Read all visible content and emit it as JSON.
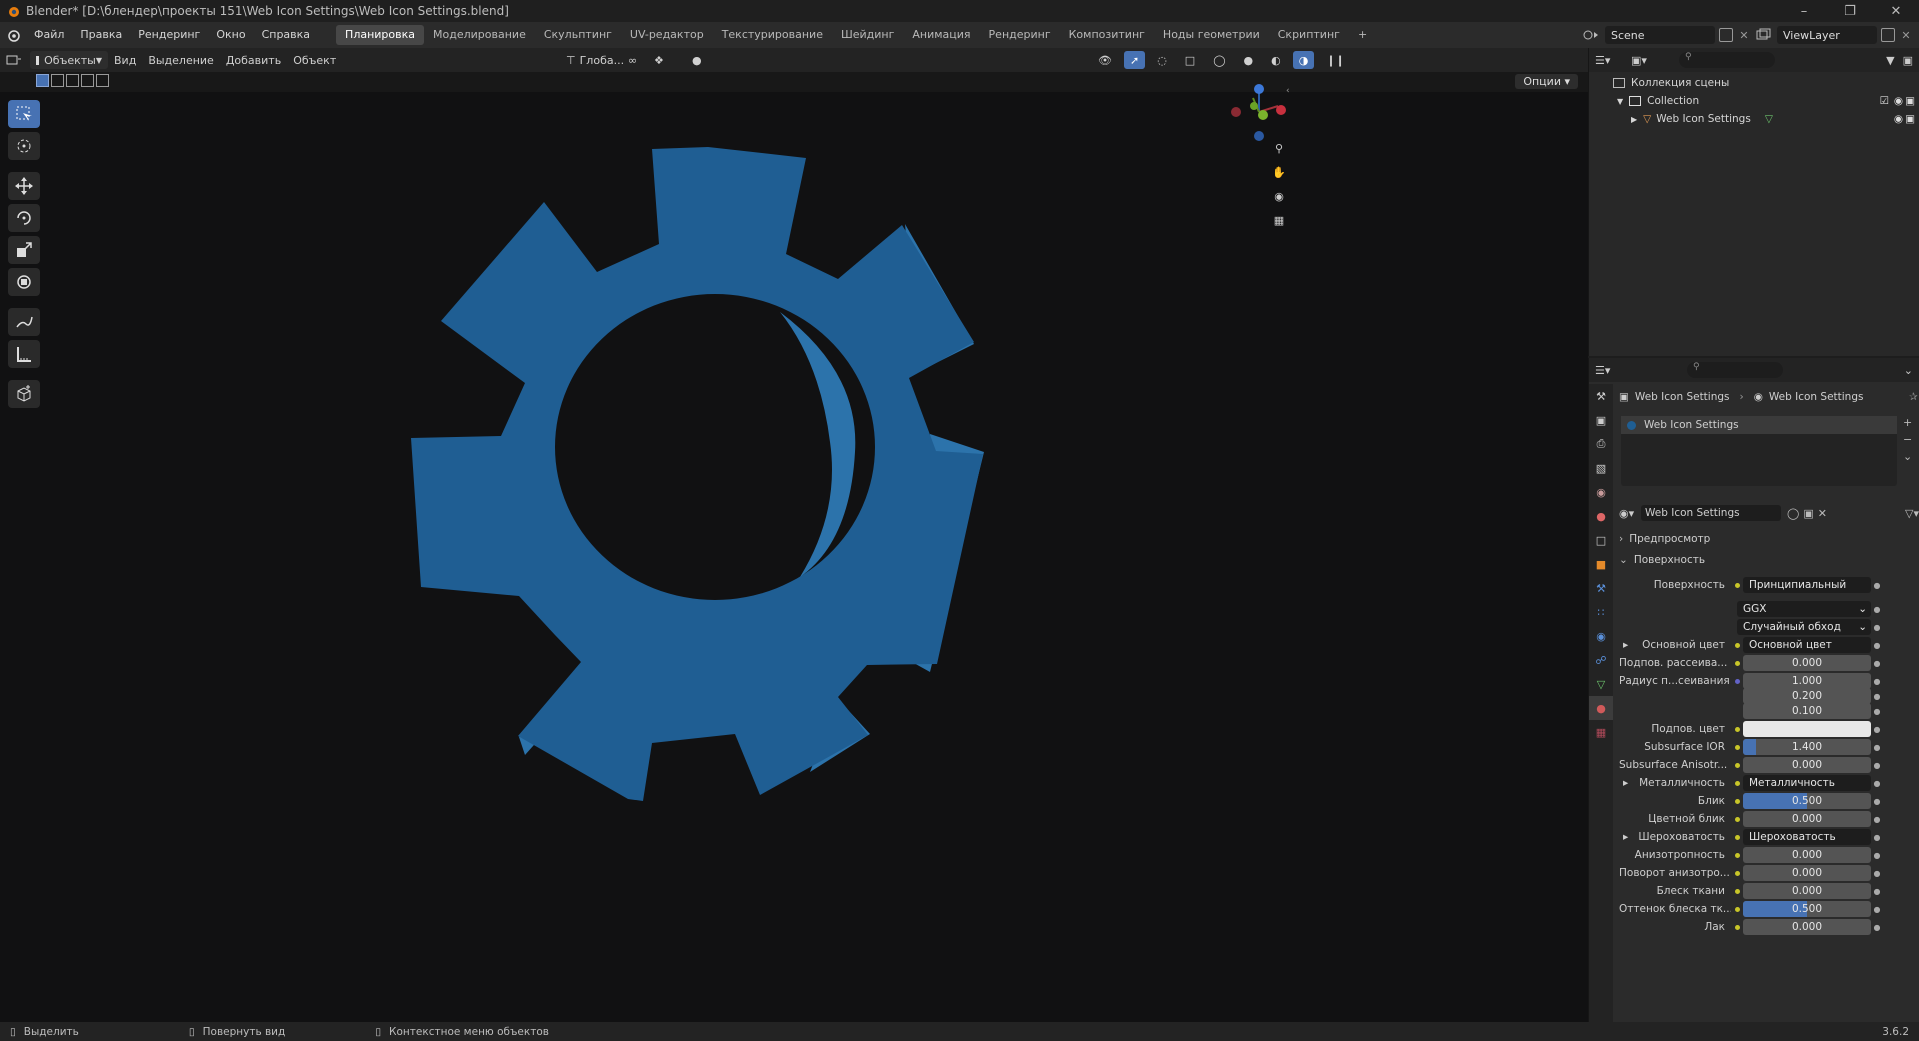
{
  "window": {
    "title": "Blender* [D:\\блендер\\проекты 151\\Web Icon Settings\\Web Icon Settings.blend]"
  },
  "menu": [
    "Файл",
    "Правка",
    "Рендеринг",
    "Окно",
    "Справка"
  ],
  "workspaces": [
    "Планировка",
    "Моделирование",
    "Скульптинг",
    "UV-редактор",
    "Текстурирование",
    "Шейдинг",
    "Анимация",
    "Рендеринг",
    "Композитинг",
    "Ноды геометрии",
    "Скриптинг"
  ],
  "workspace_add": "+",
  "scene": {
    "name": "Scene",
    "view_layer": "ViewLayer"
  },
  "viewport_header": {
    "mode": "Объекты",
    "menus": [
      "Вид",
      "Выделение",
      "Добавить",
      "Объект"
    ],
    "transform": "Глоба...",
    "options": "Опции"
  },
  "outliner": {
    "root": "Коллекция сцены",
    "collection": "Collection",
    "object": "Web Icon Settings"
  },
  "properties": {
    "breadcrumb_object": "Web Icon Settings",
    "breadcrumb_material": "Web Icon Settings",
    "slot": "Web Icon Settings",
    "material_name": "Web Icon Settings",
    "panel_preview": "Предпросмотр",
    "panel_surface": "Поверхность",
    "rows": [
      {
        "label": "Поверхность",
        "value": "Принципиальный BSDF",
        "kind": "link"
      },
      {
        "label": "",
        "value": "GGX",
        "kind": "select"
      },
      {
        "label": "",
        "value": "Случайный обход",
        "kind": "select"
      },
      {
        "label": "Основной цвет",
        "value": "Основной цвет",
        "kind": "link",
        "expand": true
      },
      {
        "label": "Подпов. рассеива...",
        "value": "0.000",
        "kind": "num",
        "fill": 0
      },
      {
        "label": "Радиус п...сеивания",
        "value": "1.000",
        "kind": "num",
        "fill": 0,
        "dot": "blue"
      },
      {
        "label": "",
        "value": "0.200",
        "kind": "num",
        "fill": 0,
        "nodot": true
      },
      {
        "label": "",
        "value": "0.100",
        "kind": "num",
        "fill": 0,
        "nodot": true
      },
      {
        "label": "Подпов. цвет",
        "value": "",
        "kind": "color"
      },
      {
        "label": "Subsurface IOR",
        "value": "1.400",
        "kind": "num",
        "fill": 0.1
      },
      {
        "label": "Subsurface Anisotr...",
        "value": "0.000",
        "kind": "num",
        "fill": 0
      },
      {
        "label": "Металличность",
        "value": "Металличность",
        "kind": "link",
        "expand": true
      },
      {
        "label": "Блик",
        "value": "0.500",
        "kind": "num",
        "fill": 0.5
      },
      {
        "label": "Цветной блик",
        "value": "0.000",
        "kind": "num",
        "fill": 0
      },
      {
        "label": "Шероховатость",
        "value": "Шероховатость",
        "kind": "link",
        "expand": true
      },
      {
        "label": "Анизотропность",
        "value": "0.000",
        "kind": "num",
        "fill": 0
      },
      {
        "label": "Поворот анизотро...",
        "value": "0.000",
        "kind": "num",
        "fill": 0
      },
      {
        "label": "Блеск ткани",
        "value": "0.000",
        "kind": "num",
        "fill": 0
      },
      {
        "label": "Оттенок блеска тк...",
        "value": "0.500",
        "kind": "num",
        "fill": 0.5
      },
      {
        "label": "Лак",
        "value": "0.000",
        "kind": "num",
        "fill": 0
      }
    ]
  },
  "statusbar": {
    "select": "Выделить",
    "rotate": "Повернуть вид",
    "context": "Контекстное меню объектов",
    "version": "3.6.2"
  },
  "colors": {
    "gear": "#1f5e93",
    "gear_side": "#2c73ab",
    "accent": "#4772b3",
    "viewport_bg": "#111112"
  }
}
